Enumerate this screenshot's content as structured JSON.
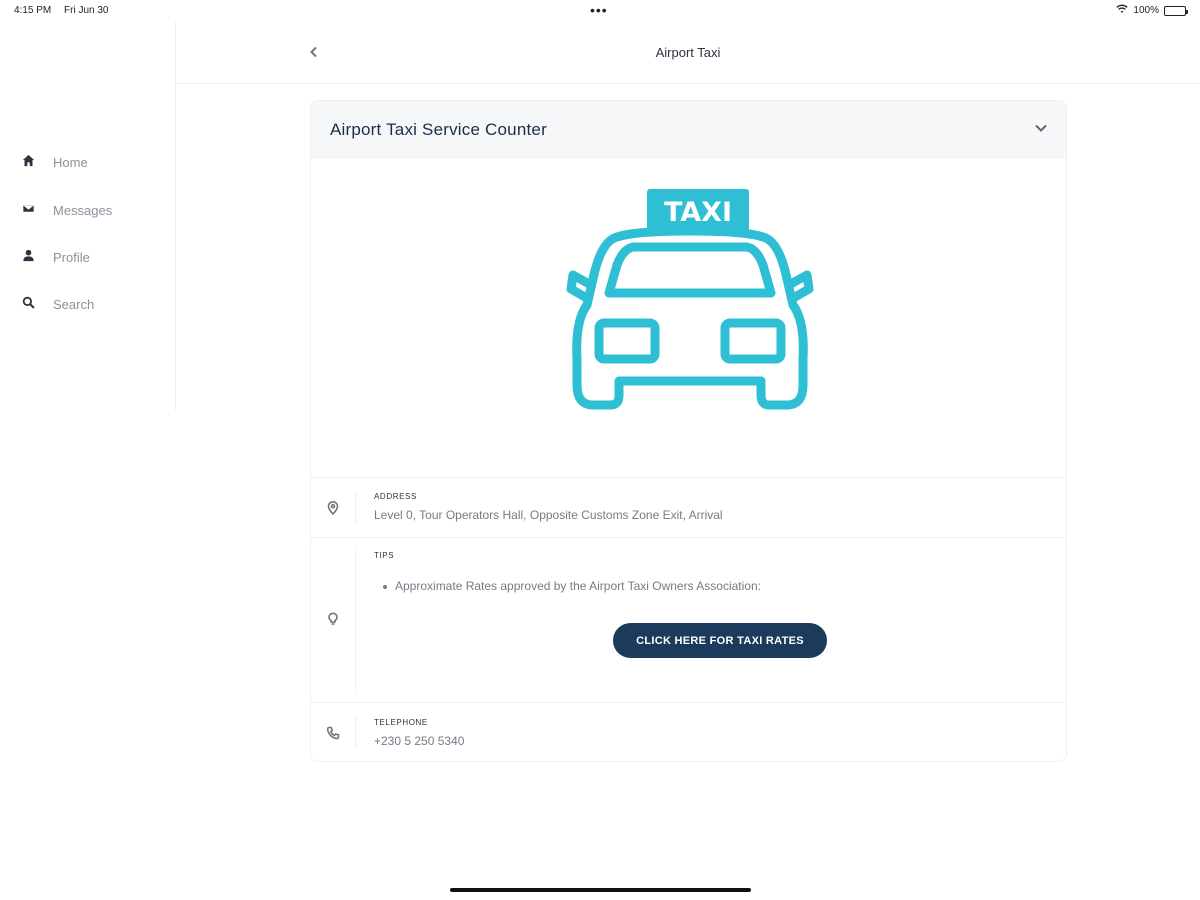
{
  "status_bar": {
    "time": "4:15 PM",
    "date": "Fri Jun 30",
    "dots": "•••",
    "battery_percent": "100%"
  },
  "sidebar": {
    "items": [
      {
        "label": "Home",
        "icon": "home-icon"
      },
      {
        "label": "Messages",
        "icon": "mail-icon"
      },
      {
        "label": "Profile",
        "icon": "person-icon"
      },
      {
        "label": "Search",
        "icon": "search-icon"
      }
    ]
  },
  "header": {
    "title": "Airport Taxi",
    "back_icon": "chevron-left-icon"
  },
  "card": {
    "title": "Airport Taxi Service Counter",
    "expand_icon": "chevron-down-icon",
    "image": {
      "sign_text": "TAXI",
      "color": "#2ebfd4"
    },
    "address": {
      "label": "ADDRESS",
      "value": "Level 0, Tour Operators Hall, Opposite Customs Zone Exit, Arrival",
      "icon": "map-pin-icon"
    },
    "tips": {
      "label": "TIPS",
      "items": [
        "Approximate Rates approved by the Airport Taxi Owners Association:"
      ],
      "button_label": "CLICK HERE FOR TAXI RATES",
      "icon": "lightbulb-icon"
    },
    "telephone": {
      "label": "TELEPHONE",
      "value": "+230 5 250 5340",
      "icon": "phone-icon"
    }
  },
  "colors": {
    "accent_taxi": "#2ebfd4",
    "button_bg": "#1b3a5c",
    "title_text": "#1d2c48"
  }
}
